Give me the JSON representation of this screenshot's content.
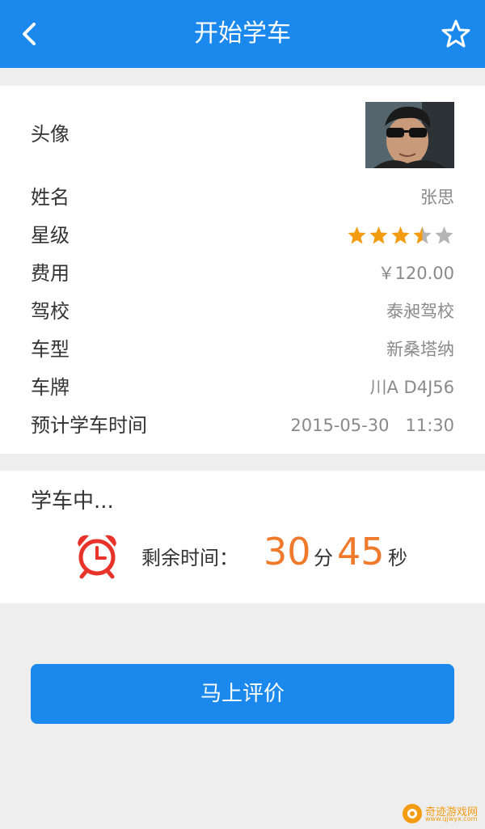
{
  "header": {
    "title": "开始学车",
    "back_icon": "chevron-left-icon",
    "favorite_icon": "star-outline-icon"
  },
  "coach": {
    "avatar_label": "头像",
    "name_label": "姓名",
    "name": "张思",
    "rating_label": "星级",
    "rating": 3.5,
    "rating_max": 5,
    "fee_label": "费用",
    "fee": "￥120.00",
    "school_label": "驾校",
    "school": "泰昶驾校",
    "car_model_label": "车型",
    "car_model": "新桑塔纳",
    "plate_label": "车牌",
    "plate": "川A D4J56",
    "scheduled_time_label": "预计学车时间",
    "scheduled_time": "2015-05-30   11:30"
  },
  "session": {
    "status": "学车中...",
    "remaining_label": "剩余时间：",
    "minutes": "30",
    "minutes_unit": "分",
    "seconds": "45",
    "seconds_unit": "秒"
  },
  "action": {
    "rate_button_label": "马上评价"
  },
  "watermark": {
    "text": "奇迹游戏网",
    "sub": "www.qjwyx.com"
  },
  "colors": {
    "primary": "#1a88ec",
    "accent": "#f07a2b",
    "star": "#f39c12",
    "star_empty": "#b5b5b5"
  }
}
